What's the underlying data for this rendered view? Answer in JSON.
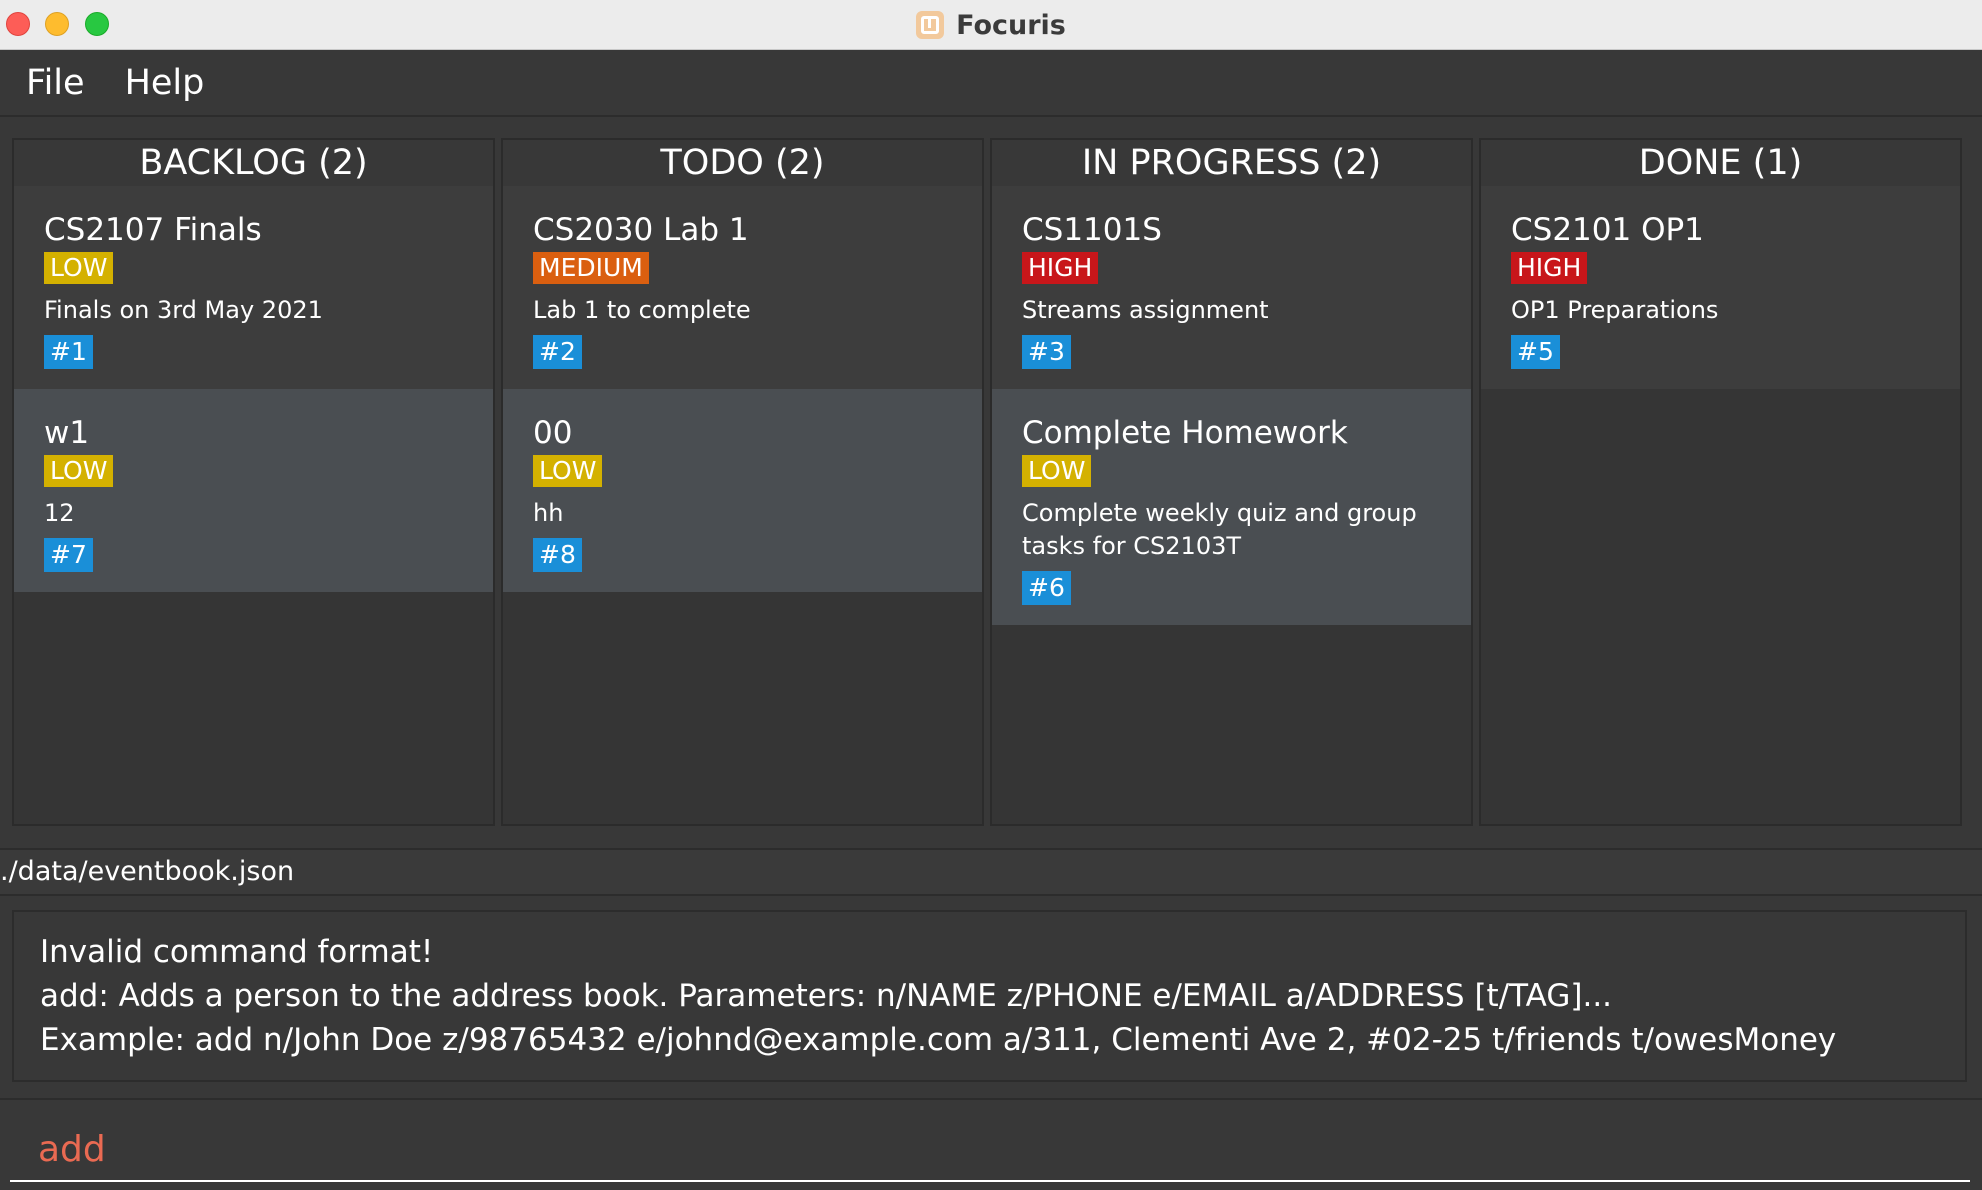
{
  "window": {
    "title": "Focuris"
  },
  "menu": {
    "file": "File",
    "help": "Help"
  },
  "columns": [
    {
      "header": "BACKLOG (2)",
      "cards": [
        {
          "title": "CS2107 Finals",
          "priority": "LOW",
          "description": "Finals on 3rd May 2021",
          "id": "#1"
        },
        {
          "title": "w1",
          "priority": "LOW",
          "description": "12",
          "id": "#7"
        }
      ]
    },
    {
      "header": "TODO (2)",
      "cards": [
        {
          "title": "CS2030 Lab 1",
          "priority": "MEDIUM",
          "description": "Lab 1 to complete",
          "id": "#2"
        },
        {
          "title": "00",
          "priority": "LOW",
          "description": "hh",
          "id": "#8"
        }
      ]
    },
    {
      "header": "IN PROGRESS (2)",
      "cards": [
        {
          "title": "CS1101S",
          "priority": "HIGH",
          "description": "Streams assignment",
          "id": "#3"
        },
        {
          "title": "Complete Homework",
          "priority": "LOW",
          "description": "Complete weekly quiz and group tasks for CS2103T",
          "id": "#6"
        }
      ]
    },
    {
      "header": "DONE (1)",
      "cards": [
        {
          "title": "CS2101 OP1",
          "priority": "HIGH",
          "description": "OP1 Preparations",
          "id": "#5"
        }
      ]
    }
  ],
  "status": {
    "path": "./data/eventbook.json"
  },
  "result": {
    "line1": "Invalid command format!",
    "line2": "add: Adds a person to the address book. Parameters: n/NAME z/PHONE e/EMAIL a/ADDRESS [t/TAG]...",
    "line3": "Example: add n/John Doe z/98765432 e/johnd@example.com a/311, Clementi Ave 2, #02-25 t/friends t/owesMoney"
  },
  "command": {
    "value": "add"
  },
  "colors": {
    "low": "#d4b100",
    "medium": "#da5f10",
    "high": "#c8161a",
    "id_badge": "#1a8fd8",
    "command_text": "#ea6a52"
  },
  "icons": {
    "app": "focuris-board-icon"
  }
}
